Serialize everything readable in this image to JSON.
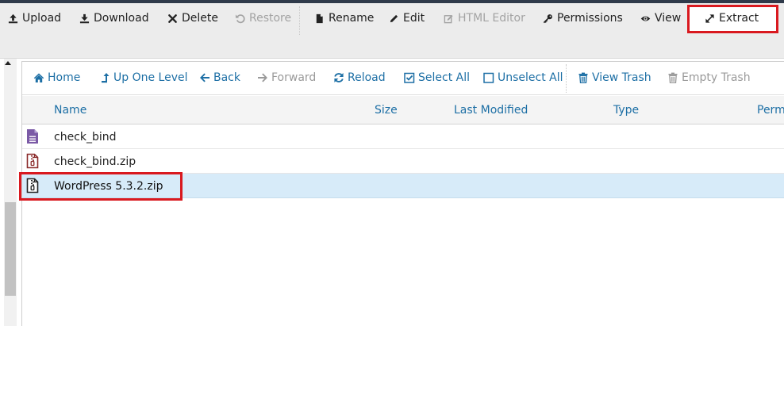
{
  "toolbar": {
    "upload": "Upload",
    "download": "Download",
    "delete": "Delete",
    "restore": "Restore",
    "rename": "Rename",
    "edit": "Edit",
    "html_editor": "HTML Editor",
    "permissions": "Permissions",
    "view": "View",
    "extract": "Extract"
  },
  "nav": {
    "home": "Home",
    "up_one_level": "Up One Level",
    "back": "Back",
    "forward": "Forward",
    "reload": "Reload",
    "select_all": "Select All",
    "unselect_all": "Unselect All",
    "view_trash": "View Trash",
    "empty_trash": "Empty Trash"
  },
  "columns": {
    "name": "Name",
    "size": "Size",
    "last_modified": "Last Modified",
    "type": "Type",
    "permissions": "Perm"
  },
  "files": [
    {
      "name": "check_bind",
      "icon": "text-file-icon",
      "selected": false
    },
    {
      "name": "check_bind.zip",
      "icon": "zip-file-icon",
      "selected": false
    },
    {
      "name": "WordPress 5.3.2.zip",
      "icon": "zip-file-icon",
      "selected": true
    }
  ],
  "colors": {
    "accent": "#1d6fa5",
    "highlight": "#d9191f",
    "selected_row": "#d7ebf9",
    "text_file": "#7b5aa6",
    "zip_file": "#8a2a2a"
  }
}
